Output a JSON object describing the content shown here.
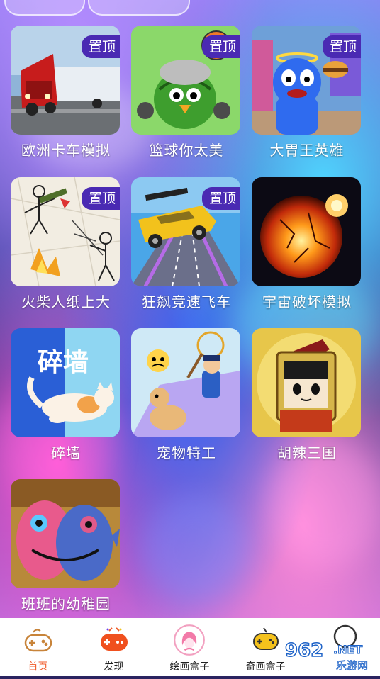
{
  "games": [
    {
      "title": "欧洲卡车模拟",
      "pinned": true
    },
    {
      "title": "篮球你太美",
      "pinned": true
    },
    {
      "title": "大胃王英雄",
      "pinned": true
    },
    {
      "title": "火柴人纸上大",
      "pinned": true
    },
    {
      "title": "狂飙竞速飞车",
      "pinned": true
    },
    {
      "title": "宇宙破坏模拟",
      "pinned": false
    },
    {
      "title": "碎墙",
      "pinned": false,
      "thumb_text": "碎墙"
    },
    {
      "title": "宠物特工",
      "pinned": false
    },
    {
      "title": "胡辣三国",
      "pinned": false
    },
    {
      "title": "班班的幼稚园",
      "pinned": false
    }
  ],
  "badge_label": "置顶",
  "nav": [
    {
      "label": "首页",
      "active": true,
      "icon": "gamepad-icon"
    },
    {
      "label": "发现",
      "active": false,
      "icon": "game-controller-icon"
    },
    {
      "label": "绘画盒子",
      "active": false,
      "icon": "painting-avatar-icon"
    },
    {
      "label": "奇画盒子",
      "active": false,
      "icon": "joystick-icon"
    },
    {
      "label": "",
      "active": false,
      "icon": "profile-icon"
    }
  ],
  "watermark": {
    "number": "962",
    "suffix": ".NET",
    "text": "乐游网"
  },
  "colors": {
    "accent": "#f05a28",
    "badge": "#4a2ab3"
  }
}
